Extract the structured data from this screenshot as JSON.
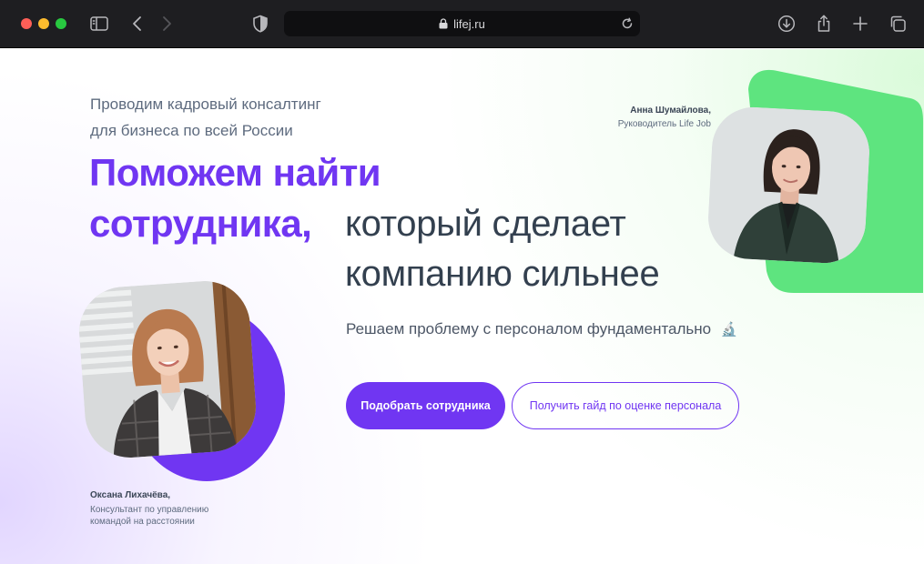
{
  "browser": {
    "url": "lifej.ru",
    "icons": {
      "sidebar": "sidebar-icon",
      "back": "chevron-left-icon",
      "forward": "chevron-right-icon",
      "privacy": "shield-icon",
      "reload": "reload-icon",
      "download": "download-icon",
      "share": "share-icon",
      "new_tab": "plus-icon",
      "tabs": "tabs-overview-icon"
    }
  },
  "hero": {
    "subtitle_line1": "Проводим кадровый консалтинг",
    "subtitle_line2": "для бизнеса по всей России",
    "headline_accent_line1": "Поможем найти",
    "headline_accent_line2": "сотрудника,",
    "headline_plain_line1": "который сделает",
    "headline_plain_line2": "компанию сильнее",
    "tagline": "Решаем проблему с персоналом фундаментально",
    "tagline_icon": "🔬",
    "primary_button": "Подобрать сотрудника",
    "secondary_button": "Получить гайд по оценке персонала"
  },
  "people": {
    "right": {
      "name": "Анна Шумайлова,",
      "role": "Руководитель Life Job"
    },
    "left": {
      "name": "Оксана Лихачёва,",
      "role_line1": "Консультант по управлению",
      "role_line2": "командой на расстоянии"
    }
  },
  "colors": {
    "accent": "#7036f2",
    "green": "#5ee47f",
    "text_dark": "#33404f"
  }
}
